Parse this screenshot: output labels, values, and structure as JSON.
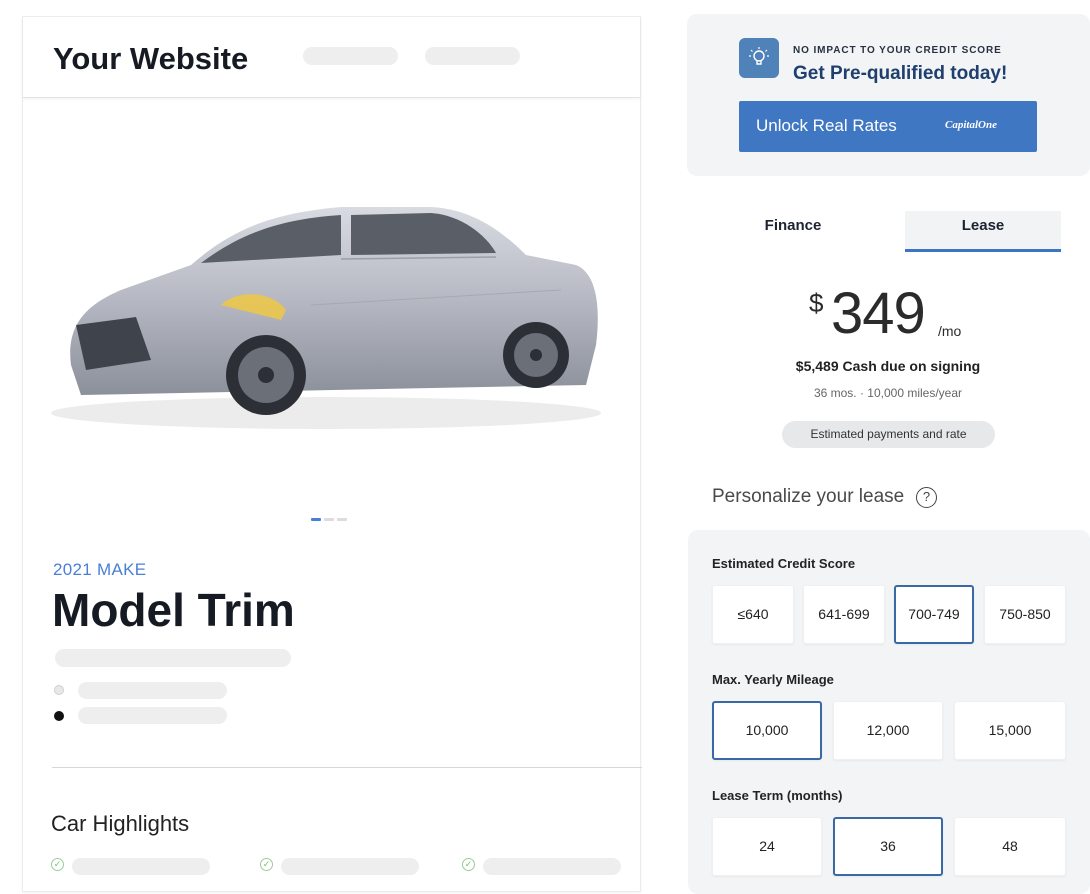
{
  "site": {
    "title": "Your Website"
  },
  "vehicle": {
    "make_label": "2021 MAKE",
    "model_title": "Model Trim"
  },
  "highlights": {
    "title": "Car Highlights"
  },
  "promo": {
    "subtitle": "NO IMPACT TO YOUR CREDIT SCORE",
    "title": "Get Pre-qualified today!",
    "button_label": "Unlock Real Rates",
    "logo_text": "CapitalOne"
  },
  "tabs": [
    {
      "label": "Finance",
      "active": false
    },
    {
      "label": "Lease",
      "active": true
    }
  ],
  "pricing": {
    "currency": "$",
    "amount": "349",
    "period": "/mo",
    "cash_due": "$5,489 Cash due on signing",
    "terms": "36 mos. · 10,000 miles/year",
    "badge": "Estimated payments and rate"
  },
  "personalize": {
    "title": "Personalize your lease",
    "help_icon": "?"
  },
  "credit_score": {
    "label": "Estimated Credit Score",
    "options": [
      "≤640",
      "641-699",
      "700-749",
      "750-850"
    ],
    "selected": "700-749"
  },
  "mileage": {
    "label": "Max. Yearly Mileage",
    "options": [
      "10,000",
      "12,000",
      "15,000"
    ],
    "selected": "10,000"
  },
  "lease_term": {
    "label": "Lease Term (months)",
    "options": [
      "24",
      "36",
      "48"
    ],
    "selected": "36"
  },
  "colors": {
    "accent": "#3a76c2",
    "promo_button": "#3f77c3",
    "make_label": "#4a7fd6",
    "selected_border": "#3a6aa6"
  }
}
